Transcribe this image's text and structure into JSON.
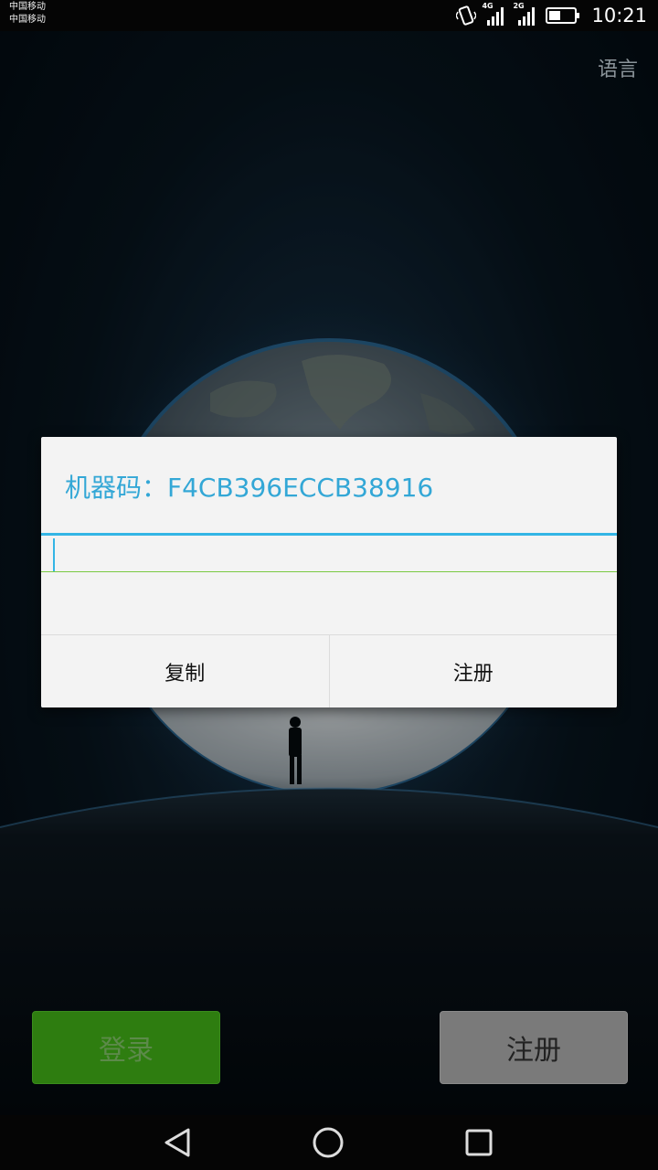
{
  "status_bar": {
    "carrier_1": "中国移动",
    "carrier_2": "中国移动",
    "network_1": "4G",
    "network_2": "2G",
    "time": "10:21",
    "icons": [
      "vibrate-icon",
      "signal-icon",
      "signal-icon",
      "battery-icon"
    ]
  },
  "header": {
    "language_label": "语言"
  },
  "dialog": {
    "title": "机器码：F4CB396ECCB38916",
    "input_value": "",
    "copy_label": "复制",
    "register_label": "注册",
    "accent_color": "#33b5e5"
  },
  "actions": {
    "login_label": "登录",
    "register_label": "注册",
    "login_color": "#2e7d10",
    "register_color": "#7a7a7a"
  },
  "nav_bar": {
    "icons": [
      "back-icon",
      "home-icon",
      "recent-apps-icon"
    ]
  }
}
